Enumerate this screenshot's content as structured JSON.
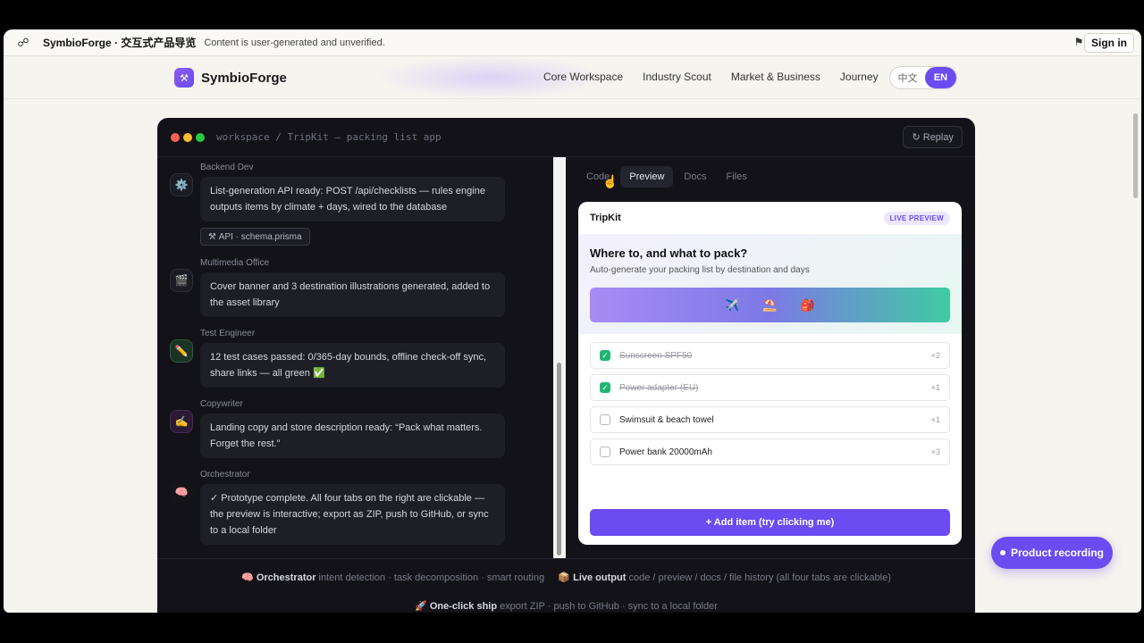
{
  "topbar": {
    "title": "SymbioForge · 交互式产品导览",
    "notice": "Content is user-generated and unverified.",
    "sign_in": "Sign in",
    "app_icon": "share-network-icon",
    "flag_icon": "flag-icon"
  },
  "nav": {
    "brand": "SymbioForge",
    "links": [
      "Core Workspace",
      "Industry Scout",
      "Market & Business",
      "Journey"
    ],
    "lang_zh": "中文",
    "lang_en": "EN"
  },
  "window": {
    "path": "workspace / TripKit — packing list app",
    "replay": "Replay",
    "dots": [
      "#ff5f57",
      "#febc2e",
      "#28c840"
    ]
  },
  "chat": [
    {
      "role": "Backend Dev",
      "icon": "gear-icon",
      "text": "List-generation API ready: POST /api/checklists — rules engine outputs items by climate + days, wired to the database",
      "chip": "API · schema.prisma"
    },
    {
      "role": "Multimedia Office",
      "icon": "media-icon",
      "text": "Cover banner and 3 destination illustrations generated, added to the asset library"
    },
    {
      "role": "Test Engineer",
      "icon": "pencil-icon",
      "text": "12 test cases passed: 0/365-day bounds, offline check-off sync, share links — all green ✅"
    },
    {
      "role": "Copywriter",
      "icon": "writing-hand-icon",
      "text": "Landing copy and store description ready: “Pack what matters. Forget the rest.”"
    },
    {
      "role": "Orchestrator",
      "icon": "brain-icon",
      "text": "✓ Prototype complete. All four tabs on the right are clickable — the preview is interactive; export as ZIP, push to GitHub, or sync to a local folder"
    }
  ],
  "tabs": [
    "Code",
    "Preview",
    "Docs",
    "Files"
  ],
  "active_tab": "Preview",
  "preview": {
    "app_name": "TripKit",
    "badge": "LIVE PREVIEW",
    "heading": "Where to, and what to pack?",
    "subheading": "Auto-generate your packing list by destination and days",
    "banner_icons": [
      "✈️",
      "⛱️",
      "🎒"
    ],
    "items": [
      {
        "label": "Sunscreen SPF50",
        "qty": "×2",
        "checked": true
      },
      {
        "label": "Power adapter (EU)",
        "qty": "×1",
        "checked": true
      },
      {
        "label": "Swimsuit & beach towel",
        "qty": "×1",
        "checked": false
      },
      {
        "label": "Power bank 20000mAh",
        "qty": "×3",
        "checked": false
      }
    ],
    "add_button": "+ Add item (try clicking me)"
  },
  "footer": {
    "line1": [
      {
        "icon": "🧠",
        "bold": "Orchestrator",
        "rest": "intent detection · task decomposition · smart routing"
      },
      {
        "icon": "📦",
        "bold": "Live output",
        "rest": "code / preview / docs / file history (all four tabs are clickable)"
      }
    ],
    "line2": {
      "icon": "🚀",
      "bold": "One-click ship",
      "rest": "export ZIP · push to GitHub · sync to a local folder"
    }
  },
  "recording": "Product recording"
}
